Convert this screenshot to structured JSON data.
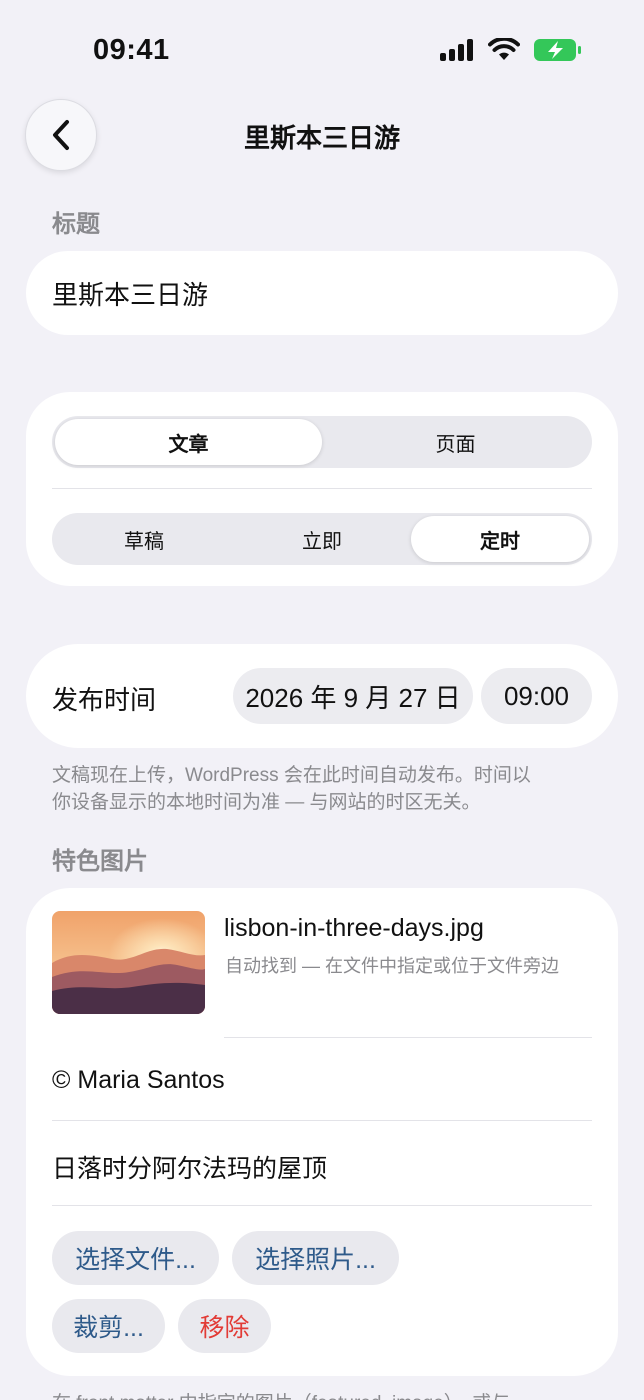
{
  "status": {
    "time": "09:41"
  },
  "nav": {
    "title": "里斯本三日游"
  },
  "title_section": {
    "label": "标题",
    "value": "里斯本三日游"
  },
  "type_segment": {
    "options": [
      "文章",
      "页面"
    ],
    "selected": "文章"
  },
  "status_segment": {
    "options": [
      "草稿",
      "立即",
      "定时"
    ],
    "selected": "定时"
  },
  "publish": {
    "label": "发布时间",
    "date": "2026 年 9 月 27 日",
    "time": "09:00",
    "note_line1": "文稿现在上传，WordPress 会在此时间自动发布。时间以",
    "note_line2": "你设备显示的本地时间为准 — 与网站的时区无关。"
  },
  "featured": {
    "label": "特色图片",
    "file_name": "lisbon-in-three-days.jpg",
    "file_sub": "自动找到 — 在文件中指定或位于文件旁边",
    "credit": "© Maria Santos",
    "caption": "日落时分阿尔法玛的屋顶",
    "buttons": {
      "choose_file": "选择文件...",
      "choose_photo": "选择照片...",
      "crop": "裁剪...",
      "remove": "移除"
    }
  },
  "footer_note": "在 front matter 中指定的图片（featured_image），或与",
  "colors": {
    "background": "#f2f1f7",
    "link_blue": "#2e5a8a",
    "danger_red": "#e23b36",
    "battery_green": "#34c759"
  }
}
